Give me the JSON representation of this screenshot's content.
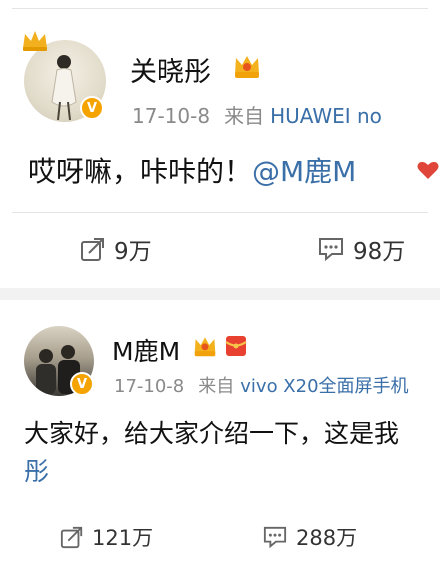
{
  "posts": [
    {
      "username": "关晓彤",
      "date": "17-10-8",
      "from_label": "来自",
      "source": "HUAWEI no",
      "text": "哎呀嘛，咔咔的！",
      "mention": "@M鹿M",
      "reposts": "9万",
      "comments": "98万",
      "icons": [
        "crown-icon",
        "verified-v-icon",
        "vip-crown-icon",
        "repost-icon",
        "comment-icon",
        "heart-icon"
      ]
    },
    {
      "username": "M鹿M",
      "date": "17-10-8",
      "from_label": "来自",
      "source": "vivo X20全面屏手机",
      "text": "大家好，给大家介绍一下，这是我",
      "text_wrap": "彤",
      "reposts": "121万",
      "comments": "288万",
      "icons": [
        "verified-v-icon",
        "vip-crown-icon",
        "red-envelope-icon",
        "repost-icon",
        "comment-icon"
      ]
    }
  ],
  "colors": {
    "link": "#3a6fa8",
    "meta": "#8a8a8a",
    "verified": "#f5a300",
    "divider": "#e4e4e4"
  }
}
